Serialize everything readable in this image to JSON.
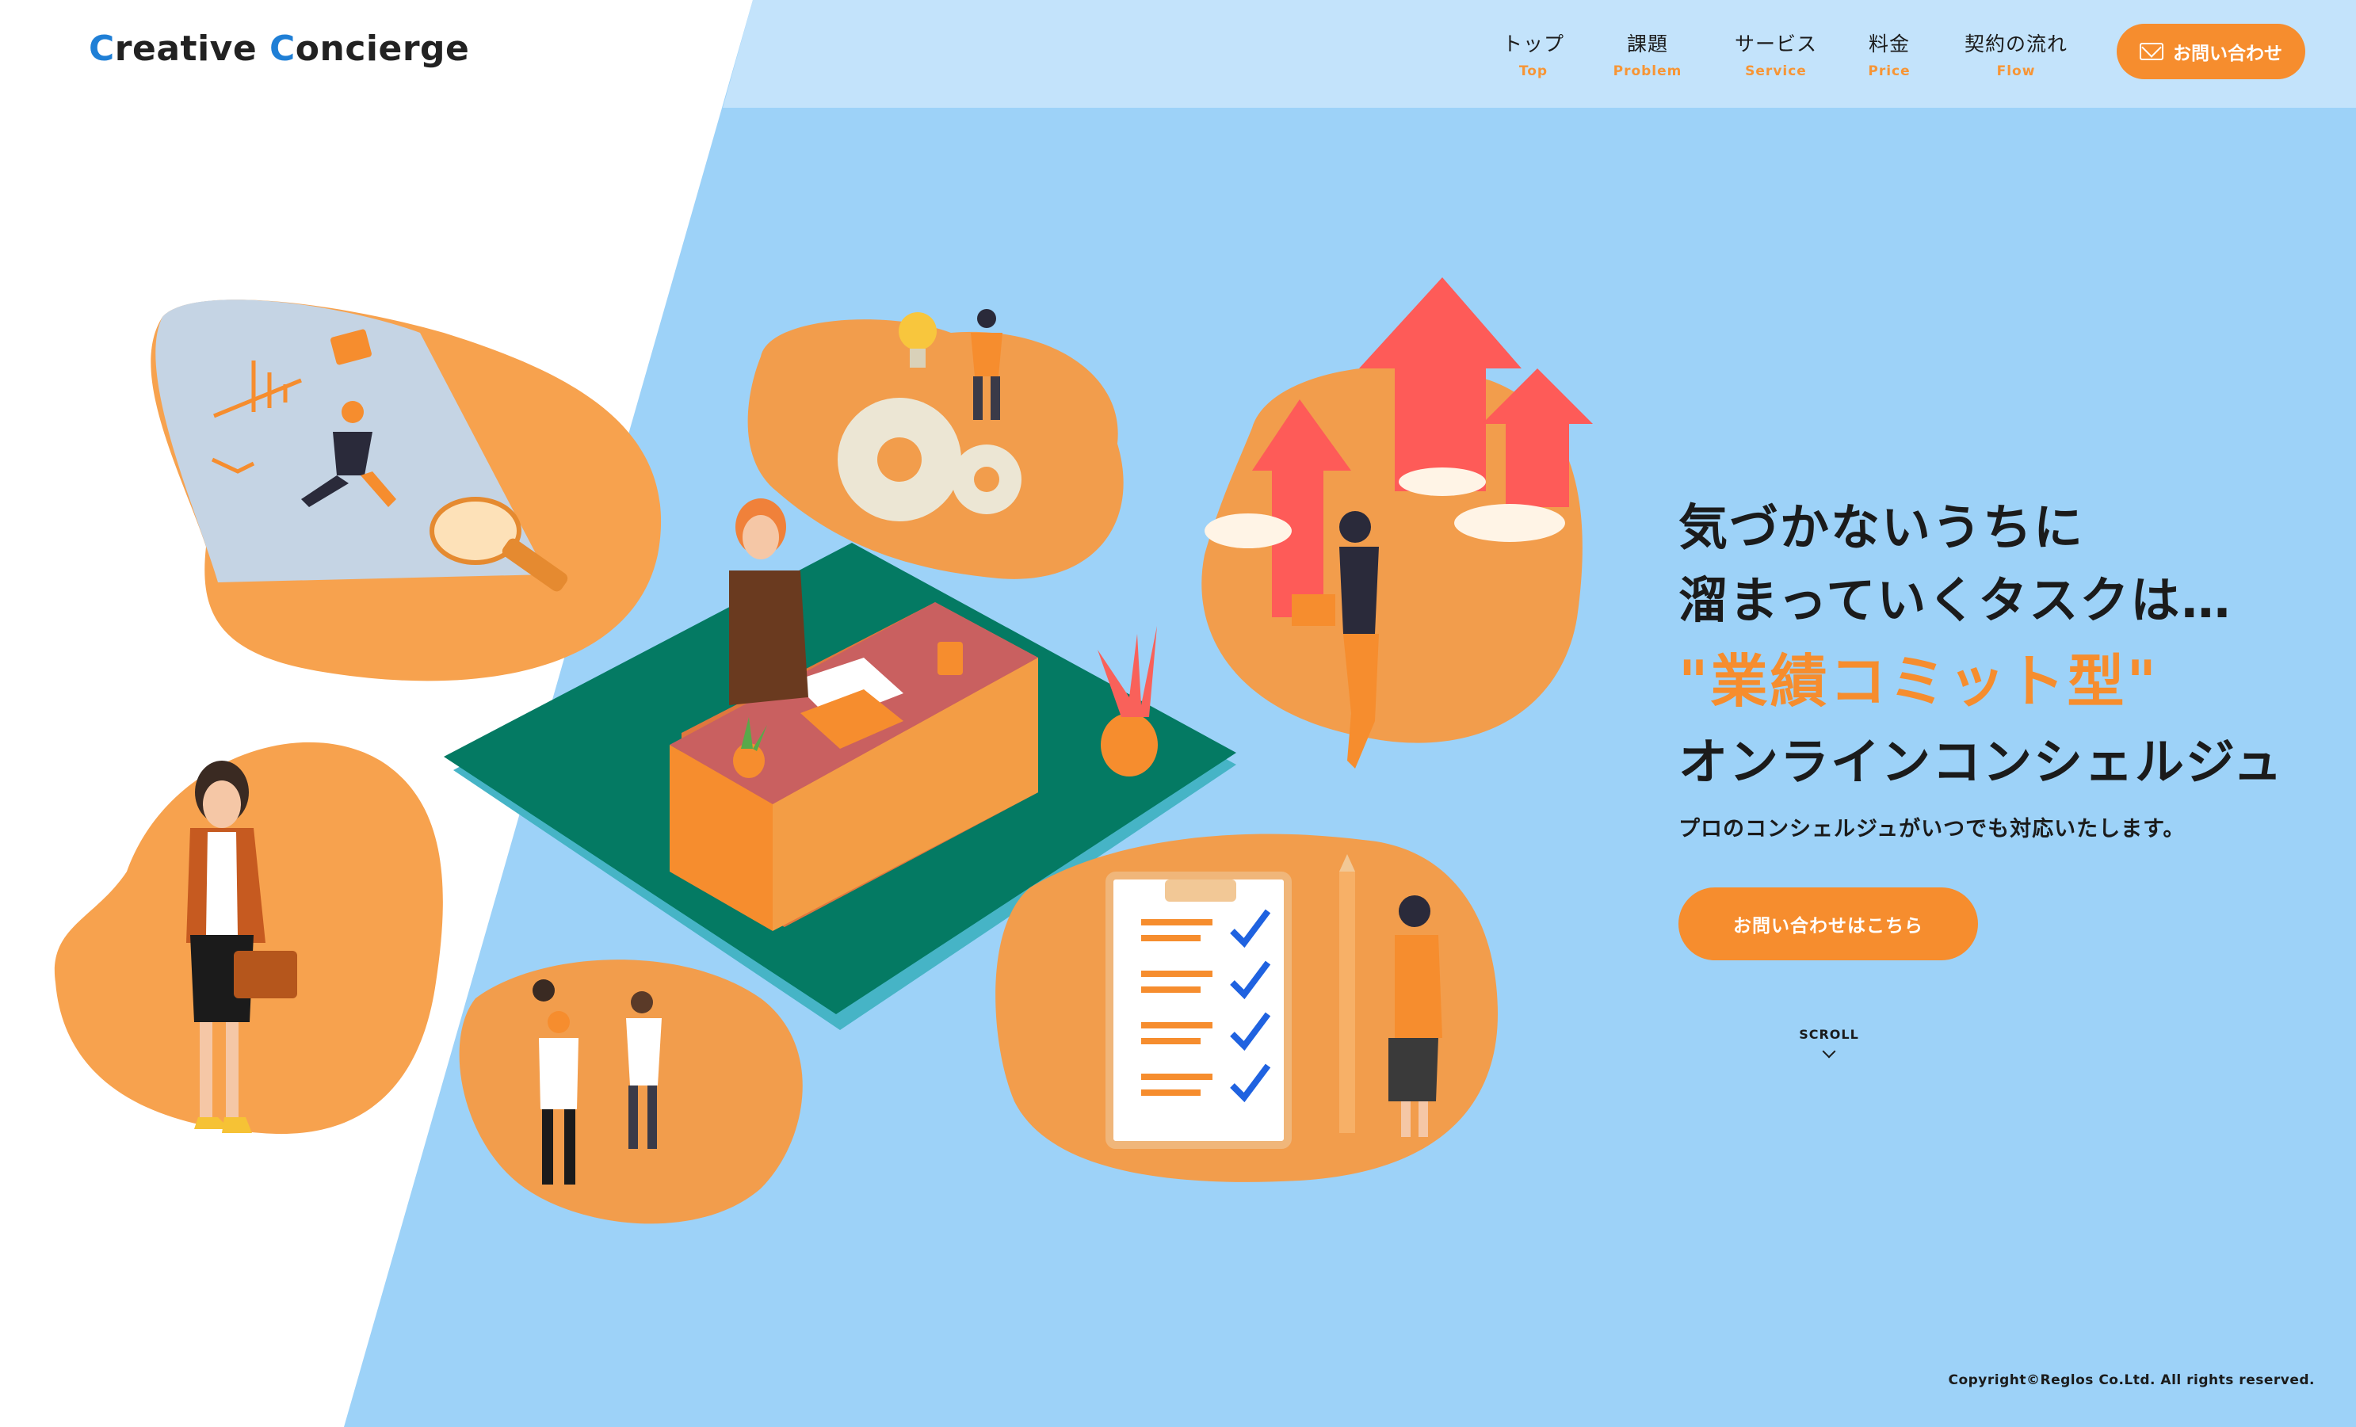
{
  "brand": {
    "logo_first_cap": "C",
    "logo_first_rest": "reative ",
    "logo_second_cap": "C",
    "logo_second_rest": "oncierge"
  },
  "nav": {
    "items": [
      {
        "jp": "トップ",
        "en": "Top"
      },
      {
        "jp": "課題",
        "en": "Problem"
      },
      {
        "jp": "サービス",
        "en": "Service"
      },
      {
        "jp": "料金",
        "en": "Price"
      },
      {
        "jp": "契約の流れ",
        "en": "Flow"
      }
    ],
    "contact_label": "お問い合わせ",
    "contact_icon": "mail-icon"
  },
  "hero": {
    "line1": "気づかないうちに",
    "line2": "溜まっていくタスクは…",
    "accent": "\"業績コミット型\"",
    "line3": "オンラインコンシェルジュ",
    "sub": "プロのコンシェルジュがいつでも対応いたします。",
    "cta_label": "お問い合わせはこちら"
  },
  "scroll": {
    "label": "SCROLL",
    "icon": "chevron-down-icon"
  },
  "footer": {
    "copyright": "Copyright©Reglos Co.Ltd. All rights reserved."
  },
  "colors": {
    "accent": "#f68d2e",
    "sky": "#9dd2f8",
    "header_sky": "#c3e3fb",
    "brand_blue": "#1f7fd6",
    "desk_green": "#047a63"
  }
}
